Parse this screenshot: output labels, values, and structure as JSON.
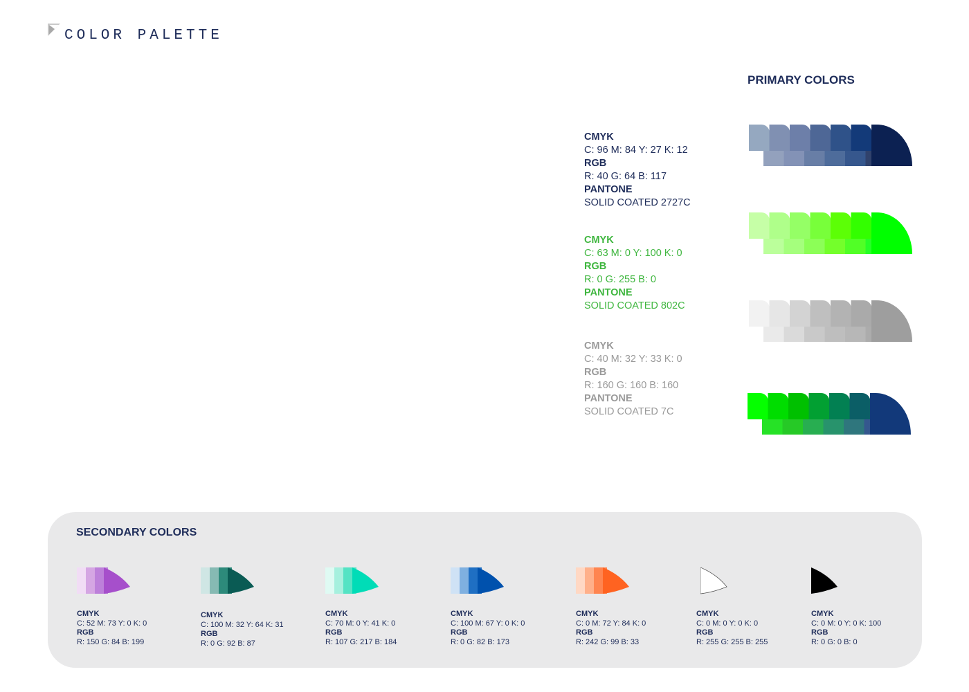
{
  "page": {
    "title": "COLOR PALETTE"
  },
  "primary": {
    "heading": "PRIMARY COLORS",
    "specs": [
      {
        "cmyk_label": "CMYK",
        "cmyk": "C: 96 M: 84 Y: 27 K: 12",
        "rgb_label": "RGB",
        "rgb": "R: 40 G: 64 B: 117",
        "pantone_label": "PANTONE",
        "pantone": "SOLID COATED 2727C"
      },
      {
        "cmyk_label": "CMYK",
        "cmyk": "C: 63 M: 0 Y: 100 K: 0",
        "rgb_label": "RGB",
        "rgb": "R: 0 G: 255 B: 0",
        "pantone_label": "PANTONE",
        "pantone": "SOLID COATED 802C"
      },
      {
        "cmyk_label": "CMYK",
        "cmyk": "C: 40 M: 32 Y: 33 K: 0",
        "rgb_label": "RGB",
        "rgb": "R: 160 G: 160 B: 160",
        "pantone_label": "PANTONE",
        "pantone": "SOLID COATED 7C"
      }
    ],
    "swatches": [
      {
        "name": "navy",
        "colors": [
          "#95a8c0",
          "#8090b2",
          "#6d7fa9",
          "#4e6796",
          "#2f5289",
          "#133a79",
          "#0c2152"
        ]
      },
      {
        "name": "green",
        "colors": [
          "#c6ffa7",
          "#afff8a",
          "#95ff66",
          "#78ff3a",
          "#5cff06",
          "#33ff00",
          "#00ff00"
        ]
      },
      {
        "name": "gray",
        "colors": [
          "#f2f2f2",
          "#e6e6e6",
          "#d3d3d3",
          "#bfbfbf",
          "#b3b3b3",
          "#aaaaaa",
          "#9e9e9e"
        ]
      },
      {
        "name": "green-to-navy",
        "colors": [
          "#05ff00",
          "#00dd00",
          "#00c000",
          "#02a032",
          "#028052",
          "#0b5e66",
          "#12397a"
        ]
      }
    ]
  },
  "secondary": {
    "heading": "SECONDARY COLORS",
    "items": [
      {
        "name": "purple",
        "colors": [
          "#f1ddf5",
          "#d5a6e3",
          "#bd80da",
          "#a64fcb"
        ],
        "cmyk_label": "CMYK",
        "cmyk": "C: 52 M: 73 Y: 0 K: 0",
        "rgb_label": "RGB",
        "rgb": "R: 150 G: 84 B: 199"
      },
      {
        "name": "teal",
        "colors": [
          "#cfe6e4",
          "#86bab3",
          "#2d8a7b",
          "#0a5b54"
        ],
        "cmyk_label": "CMYK",
        "cmyk": "C: 100 M: 32 Y: 64 K: 31",
        "rgb_label": "RGB",
        "rgb": "R: 0 G: 92 B: 87"
      },
      {
        "name": "turquoise",
        "colors": [
          "#dffaf3",
          "#a6f0de",
          "#54e3c4",
          "#00dcb7"
        ],
        "cmyk_label": "CMYK",
        "cmyk": "C: 70 M: 0 Y: 41 K: 0",
        "rgb_label": "RGB",
        "rgb": "R: 107 G: 217 B: 184"
      },
      {
        "name": "blue",
        "colors": [
          "#cfe2f5",
          "#7fb0e0",
          "#1f6fc3",
          "#0051ad"
        ],
        "cmyk_label": "CMYK",
        "cmyk": "C: 100 M: 67 Y: 0 K: 0",
        "rgb_label": "RGB",
        "rgb": "R: 0 G: 82 B: 173"
      },
      {
        "name": "orange",
        "colors": [
          "#ffd8c4",
          "#ffb08a",
          "#ff8550",
          "#ff6321"
        ],
        "cmyk_label": "CMYK",
        "cmyk": "C: 0 M: 72 Y: 84 K: 0",
        "rgb_label": "RGB",
        "rgb": "R: 242 G: 99 B: 33"
      },
      {
        "name": "white",
        "colors": [
          "#ffffff"
        ],
        "cmyk_label": "CMYK",
        "cmyk": "C: 0 M: 0 Y: 0 K: 0",
        "rgb_label": "RGB",
        "rgb": "R: 255 G: 255 B: 255"
      },
      {
        "name": "black",
        "colors": [
          "#000000"
        ],
        "cmyk_label": "CMYK",
        "cmyk": "C: 0 M: 0 Y: 0 K: 100",
        "rgb_label": "RGB",
        "rgb": "R: 0 G: 0 B: 0"
      }
    ]
  }
}
